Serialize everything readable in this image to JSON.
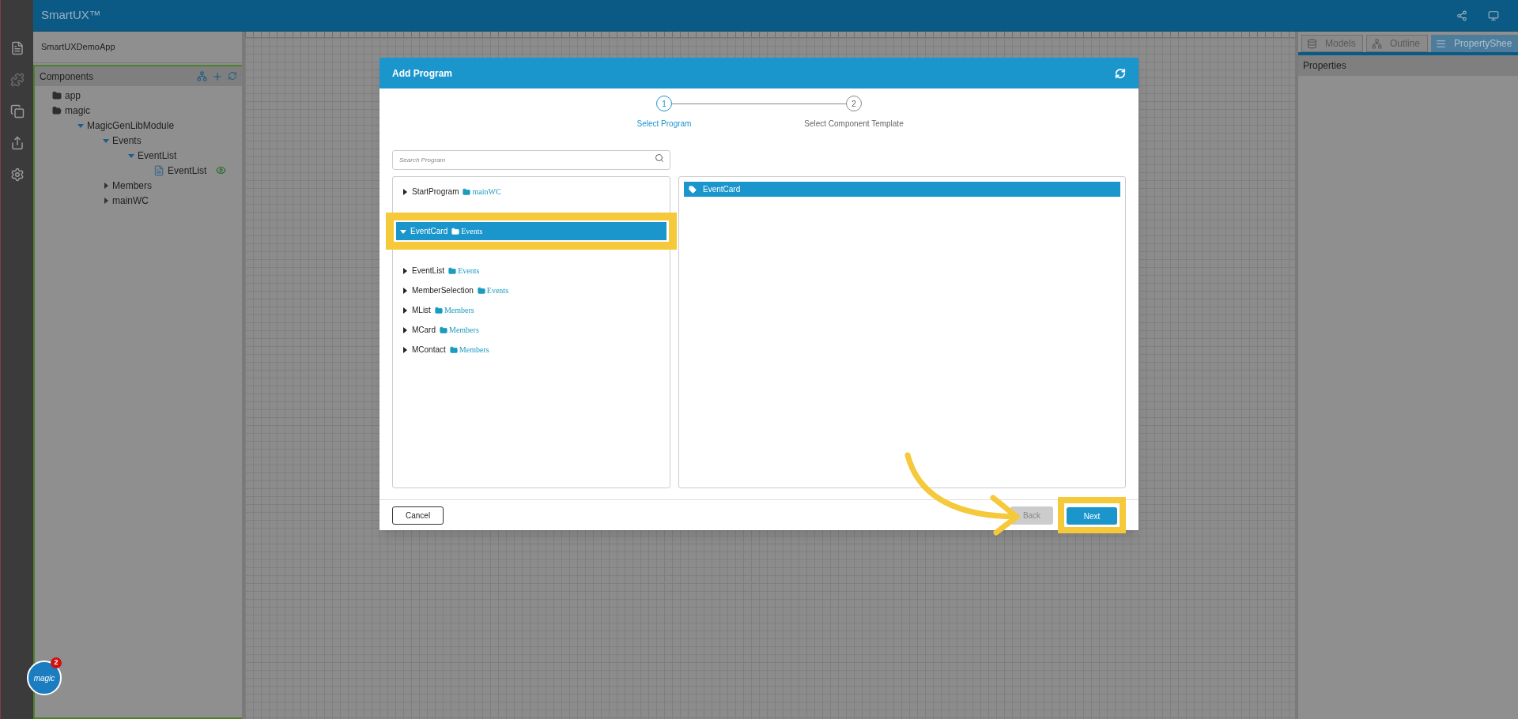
{
  "app": {
    "title": "SmartUX™"
  },
  "project": {
    "name": "SmartUXDemoApp"
  },
  "components": {
    "title": "Components",
    "tree": [
      {
        "label": "app",
        "kind": "folder",
        "expanded": false
      },
      {
        "label": "magic",
        "kind": "folder",
        "expanded": true,
        "children": [
          {
            "label": "MagicGenLibModule",
            "kind": "branch",
            "expanded": true,
            "children": [
              {
                "label": "Events",
                "kind": "branch",
                "expanded": true,
                "children": [
                  {
                    "label": "EventList",
                    "kind": "branch",
                    "expanded": true,
                    "children": [
                      {
                        "label": "EventList",
                        "kind": "file"
                      }
                    ]
                  }
                ]
              },
              {
                "label": "Members",
                "kind": "branch",
                "expanded": false
              },
              {
                "label": "mainWC",
                "kind": "branch",
                "expanded": false
              }
            ]
          }
        ]
      }
    ]
  },
  "right_panel": {
    "tabs": [
      {
        "label": "Models",
        "selected": false
      },
      {
        "label": "Outline",
        "selected": false
      },
      {
        "label": "PropertyShee",
        "selected": true
      }
    ],
    "section": "Properties"
  },
  "dialog": {
    "title": "Add Program",
    "steps": [
      {
        "number": "1",
        "label": "Select Program",
        "selected": true
      },
      {
        "number": "2",
        "label": "Select Component Template",
        "selected": false
      }
    ],
    "search": {
      "placeholder": "Search Program"
    },
    "programs": [
      {
        "name": "StartProgram",
        "folder": "mainWC",
        "selected": false
      },
      {
        "name": "EventCard",
        "folder": "Events",
        "selected": true
      },
      {
        "name": "EventList",
        "folder": "Events",
        "selected": false
      },
      {
        "name": "MemberSelection",
        "folder": "Events",
        "selected": false
      },
      {
        "name": "MList",
        "folder": "Members",
        "selected": false
      },
      {
        "name": "MCard",
        "folder": "Members",
        "selected": false
      },
      {
        "name": "MContact",
        "folder": "Members",
        "selected": false
      }
    ],
    "templates": [
      {
        "name": "EventCard",
        "selected": true
      }
    ],
    "buttons": {
      "cancel": "Cancel",
      "back": {
        "label": "Back",
        "disabled": true
      },
      "next": "Next"
    }
  },
  "logo": {
    "text": "magic",
    "badge": "2"
  }
}
